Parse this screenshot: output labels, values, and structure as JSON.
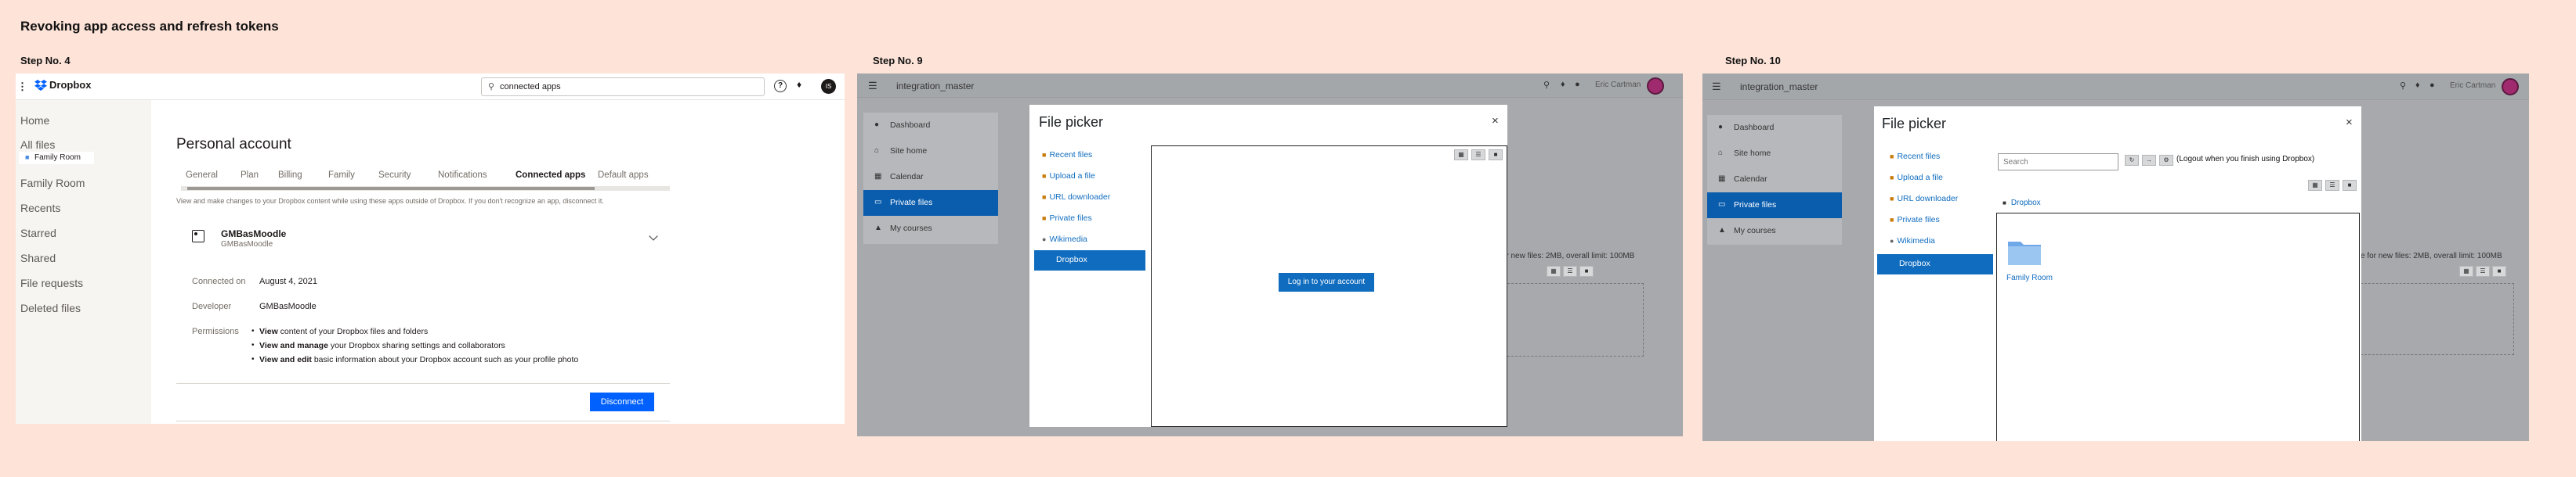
{
  "title": "Revoking app access and refresh tokens",
  "steps": [
    {
      "label": "Step No. 4"
    },
    {
      "label": "Step No. 9"
    },
    {
      "label": "Step No. 10"
    }
  ],
  "dropbox": {
    "logo": "Dropbox",
    "search_value": "connected apps",
    "avatar_initials": "IS",
    "sidebar": [
      "Home",
      "All files",
      "Family Room",
      "Family Room",
      "Recents",
      "Starred",
      "Shared",
      "File requests",
      "Deleted files"
    ],
    "heading": "Personal account",
    "tabs": [
      "General",
      "Plan",
      "Billing",
      "Family",
      "Security",
      "Notifications",
      "Connected apps",
      "Default apps"
    ],
    "description": "View and make changes to your Dropbox content while using these apps outside of Dropbox. If you don't recognize an app, disconnect it.",
    "app_name": "GMBasMoodle",
    "app_sub": "GMBasMoodle",
    "connected_on_label": "Connected on",
    "connected_on_value": "August 4, 2021",
    "developer_label": "Developer",
    "developer_value": "GMBasMoodle",
    "permissions_label": "Permissions",
    "permissions": [
      {
        "bold": "View",
        "rest": " content of your Dropbox files and folders"
      },
      {
        "bold": "View and manage",
        "rest": " your Dropbox sharing settings and collaborators"
      },
      {
        "bold": "View and edit",
        "rest": " basic information about your Dropbox account such as your profile photo"
      }
    ],
    "disconnect": "Disconnect"
  },
  "moodle": {
    "site_name": "integration_master",
    "user_name": "Eric Cartman",
    "nav": [
      "Dashboard",
      "Site home",
      "Calendar",
      "Private files",
      "My courses"
    ],
    "bg_limit_text": "for new files: 2MB, overall limit: 100MB",
    "bg_limit_text2": "e for new files: 2MB, overall limit: 100MB"
  },
  "picker": {
    "title": "File picker",
    "close": "×",
    "repos": [
      "Recent files",
      "Upload a file",
      "URL downloader",
      "Private files",
      "Wikimedia",
      "Dropbox"
    ],
    "login_button": "Log in to your account",
    "search_placeholder": "Search",
    "logout_text": "(Logout when you finish using Dropbox)",
    "breadcrumb": "Dropbox",
    "folder_name": "Family Room"
  },
  "colors": {
    "dropbox_blue": "#0061fe",
    "moodle_blue": "#0f6cbf",
    "background": "#fde3d8"
  }
}
